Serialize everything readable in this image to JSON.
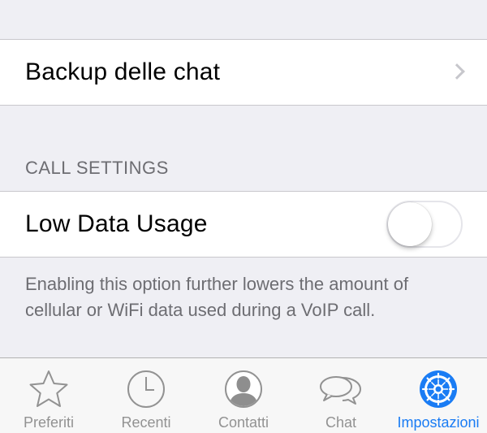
{
  "rows": {
    "backup_label": "Backup delle chat"
  },
  "call_settings": {
    "header": "CALL SETTINGS",
    "low_data_label": "Low Data Usage",
    "low_data_enabled": false,
    "footer": "Enabling this option further lowers the amount of cellular or WiFi data used during a VoIP call."
  },
  "tabbar": {
    "tabs": [
      {
        "label": "Preferiti",
        "icon": "star-icon",
        "active": false
      },
      {
        "label": "Recenti",
        "icon": "clock-icon",
        "active": false
      },
      {
        "label": "Contatti",
        "icon": "contact-icon",
        "active": false
      },
      {
        "label": "Chat",
        "icon": "chat-bubbles-icon",
        "active": false
      },
      {
        "label": "Impostazioni",
        "icon": "gear-icon",
        "active": true
      }
    ]
  },
  "colors": {
    "accent": "#1a7cf4",
    "inactive": "#929292",
    "background": "#efeff4"
  }
}
